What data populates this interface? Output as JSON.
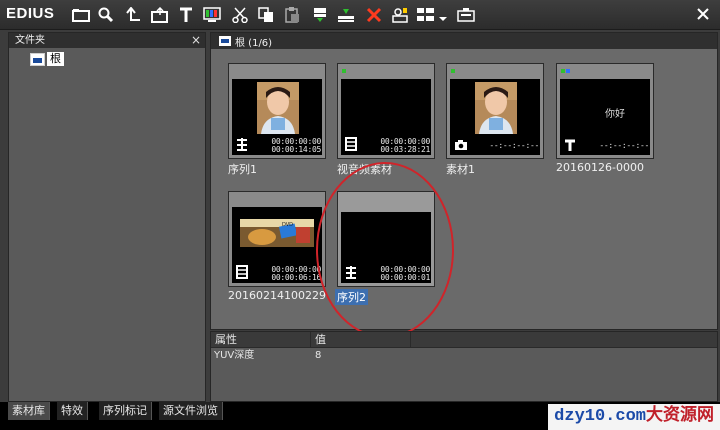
{
  "app": {
    "title": "EDIUS"
  },
  "toolbar": {
    "icons": [
      "open-folder-icon",
      "search-icon",
      "up-level-icon",
      "new-bin-icon",
      "title-icon",
      "color-bars-icon",
      "cut-icon",
      "copy-icon",
      "paste-icon",
      "insert-timeline-icon",
      "overwrite-timeline-icon",
      "delete-icon",
      "properties-icon",
      "view-mode-icon",
      "dropdown-icon",
      "capture-icon"
    ],
    "colors": {
      "delete": "#ff3b1f",
      "accent": "#30c030"
    }
  },
  "folder_panel": {
    "title": "文件夹",
    "close_label": "×",
    "root_label": "根"
  },
  "bin": {
    "title": "根 (1/6)",
    "clips": [
      {
        "label": "序列1",
        "tc_in": "00:00:00:00",
        "tc_out": "00:00:14:05",
        "type": "sequence"
      },
      {
        "label": "视音频素材",
        "tc_in": "00:00:00:00",
        "tc_out": "00:03:28:21",
        "type": "video"
      },
      {
        "label": "素材1",
        "tc_in": "",
        "tc_out": "--:--:--:--",
        "type": "still"
      },
      {
        "label": "20160126-0000",
        "tc_in": "你好",
        "tc_out": "--:--:--:--",
        "type": "title"
      },
      {
        "label": "20160214100229",
        "tc_in": "00:00:00:00",
        "tc_out": "00:00:06:16",
        "type": "video"
      },
      {
        "label": "序列2",
        "tc_in": "00:00:00:00",
        "tc_out": "00:00:00:01",
        "type": "sequence",
        "selected": true
      }
    ]
  },
  "properties": {
    "headers": [
      "属性",
      "值"
    ],
    "rows": [
      {
        "name": "YUV深度",
        "value": "8"
      }
    ]
  },
  "tabs": [
    "素材库",
    "特效",
    "序列标记",
    "源文件浏览"
  ],
  "watermark": {
    "latin": "dzy10.com",
    "cn": "大资源网"
  }
}
